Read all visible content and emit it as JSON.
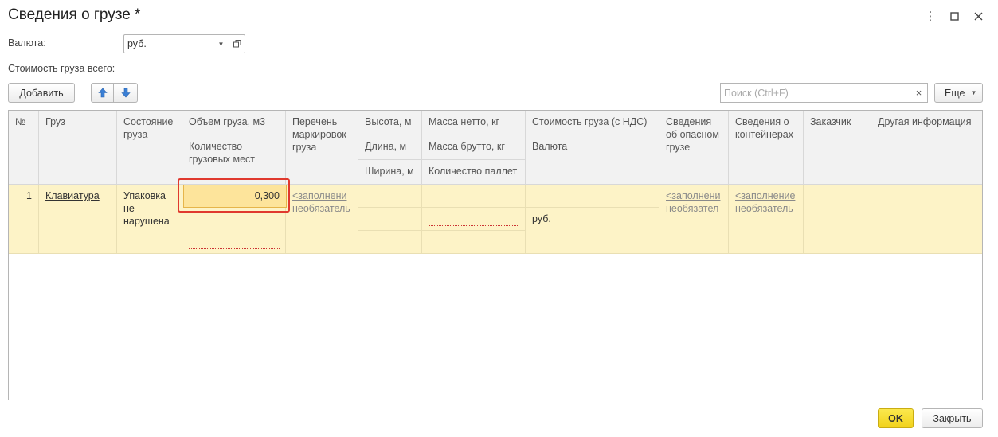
{
  "window": {
    "title": "Сведения о грузе *"
  },
  "icons": {
    "more": "more-vertical-icon",
    "maximize": "maximize-icon",
    "close": "close-icon",
    "up": "arrow-up-icon",
    "down": "arrow-down-icon"
  },
  "form": {
    "currency_label": "Валюта:",
    "currency_value": "руб.",
    "total_cost_label": "Стоимость груза всего:"
  },
  "toolbar": {
    "add_label": "Добавить",
    "search_placeholder": "Поиск (Ctrl+F)",
    "search_clear": "×",
    "more_label": "Еще"
  },
  "table": {
    "headers": {
      "num": "№",
      "cargo": "Груз",
      "state": "Состояние груза",
      "volume": "Объем груза, м3",
      "places": "Количество грузовых мест",
      "markings": "Перечень маркировок груза",
      "height": "Высота, м",
      "length": "Длина, м",
      "width": "Ширина, м",
      "net": "Масса нетто, кг",
      "gross": "Масса брутто, кг",
      "pallets": "Количество паллет",
      "cost": "Стоимость груза (с НДС)",
      "currency": "Валюта",
      "dangerous": "Сведения об опасном грузе",
      "containers": "Сведения о контейнерах",
      "customer": "Заказчик",
      "other": "Другая информация"
    },
    "rows": [
      {
        "num": "1",
        "cargo": "Клавиатура",
        "state": "Упаковка не нарушена",
        "volume": "0,300",
        "markings_hint": "<заполнени необязатель",
        "currency": "руб.",
        "dangerous_hint": "<заполнени необязател",
        "containers_hint": "<заполнение необязатель"
      }
    ]
  },
  "footer": {
    "ok_label": "OK",
    "close_label": "Закрыть"
  },
  "colors": {
    "row_bg": "#fdf3c7",
    "edit_bg": "#fde49b",
    "focus": "#e0392e",
    "ok_bg": "#f7dc2a",
    "arrow_blue": "#3a7fd5"
  }
}
